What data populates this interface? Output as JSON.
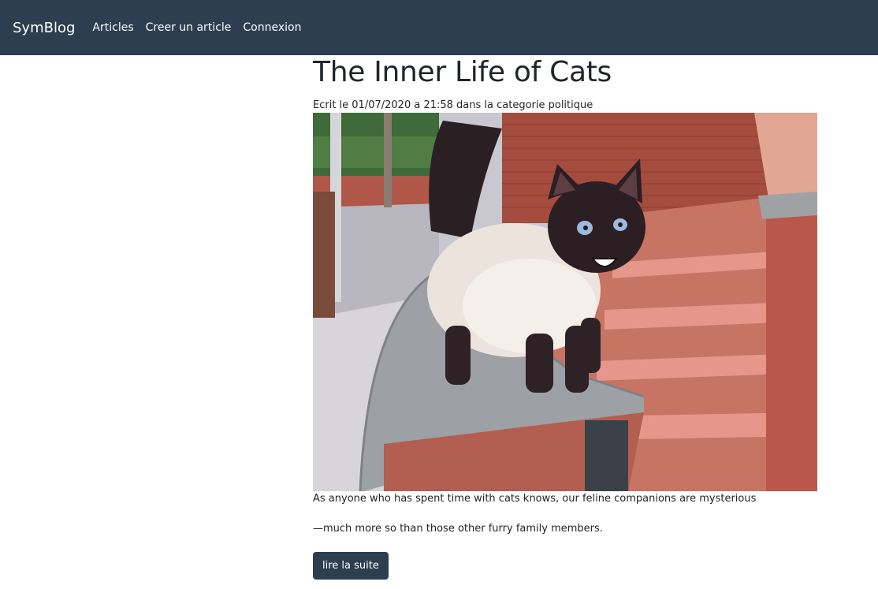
{
  "navbar": {
    "brand": "SymBlog",
    "links": [
      "Articles",
      "Creer un article",
      "Connexion"
    ]
  },
  "article": {
    "title": "The Inner Life of Cats",
    "meta": "Ecrit le 01/07/2020 a 21:58 dans la categorie politique",
    "paragraphs": [
      "As anyone who has spent time with cats knows, our feline companions are mysterious",
      "—much more so than those other furry family members."
    ],
    "read_more": "lire la suite"
  },
  "colors": {
    "navbar_bg": "#2c3e50",
    "button_bg": "#2c3e50",
    "text": "#212529"
  }
}
